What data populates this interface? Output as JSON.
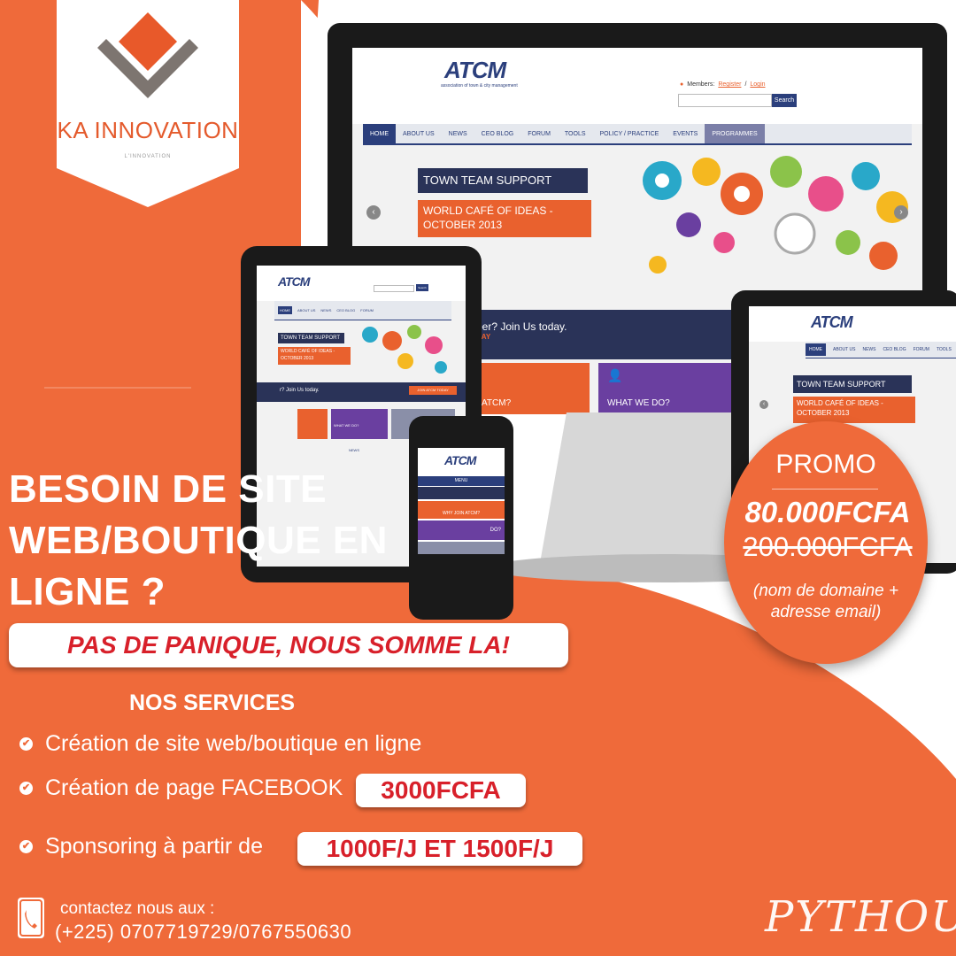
{
  "brand": {
    "name": "KA INNOVATION",
    "sub": "L'INNOVATION"
  },
  "site": {
    "logo": "ATCM",
    "logo_sub": "association of town & city management",
    "members_label": "Members:",
    "register": "Register",
    "login": "Login",
    "search_button": "Search",
    "nav": [
      "HOME",
      "ABOUT US",
      "NEWS",
      "CEO BLOG",
      "FORUM",
      "TOOLS",
      "POLICY / PRACTICE",
      "EVENTS",
      "PROGRAMMES"
    ],
    "nav_small": [
      "HOME",
      "ABOUT US",
      "NEWS",
      "CEO BLOG",
      "FORUM",
      "TOOLS"
    ],
    "slide_title": "TOWN TEAM SUPPORT",
    "slide_subtitle": "WORLD CAFÉ OF IDEAS - OCTOBER 2013",
    "join_text": "ber? Join Us today.",
    "join_text_tablet": "r? Join Us today.",
    "join_button": "JOIN ATCM TODAY",
    "day_text": "DAY",
    "tile_why": "ATCM?",
    "tile_what": "WHAT WE DO?",
    "tile_cr": "CR",
    "tile_crowd": "CROWDF",
    "tile_latest": "LATEST PR",
    "tile_news": "NEWS",
    "mobile_menu": "MENU",
    "mobile_why": "WHY JOIN ATCM?",
    "mobile_do": "DO?"
  },
  "headline": "BESOIN DE SITE WEB/BOUTIQUE EN LIGNE ?",
  "tagline": "PAS DE PANIQUE, NOUS SOMME LA!",
  "services": {
    "title": "NOS SERVICES",
    "items": [
      {
        "text": "Création de site web/boutique en ligne"
      },
      {
        "text": "Création de page FACEBOOK",
        "price": "3000FCFA"
      },
      {
        "text": "Sponsoring à partir de",
        "price": "1000F/J ET 1500F/J"
      }
    ]
  },
  "contact": {
    "label": "contactez nous aux :",
    "phone": "(+225) 0707719729/0767550630"
  },
  "promo": {
    "title": "PROMO",
    "price": "80.000FCFA",
    "old_price": "200.000FCFA",
    "note": "(nom de domaine + adresse email)"
  },
  "signature": "PYTHOUS",
  "colors": {
    "orange": "#ef6a3a",
    "navy": "#2b3f7c",
    "red": "#d8202a"
  }
}
